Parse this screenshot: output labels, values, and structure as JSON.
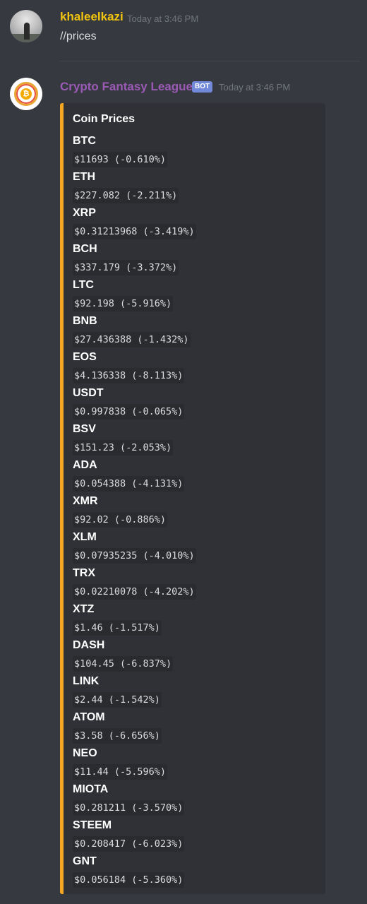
{
  "message1": {
    "username": "khaleelkazi",
    "username_color": "#f1c40f",
    "timestamp": "Today at 3:46 PM",
    "content": "//prices"
  },
  "message2": {
    "username": "Crypto Fantasy League",
    "username_color": "#9b59b6",
    "bot_tag": "BOT",
    "timestamp": "Today at 3:46 PM",
    "embed": {
      "accent_color": "#f5a623",
      "title": "Coin Prices",
      "coins": [
        {
          "name": "BTC",
          "value": "$11693 (-0.610%)"
        },
        {
          "name": "ETH",
          "value": "$227.082 (-2.211%)"
        },
        {
          "name": "XRP",
          "value": "$0.31213968 (-3.419%)"
        },
        {
          "name": "BCH",
          "value": "$337.179 (-3.372%)"
        },
        {
          "name": "LTC",
          "value": "$92.198 (-5.916%)"
        },
        {
          "name": "BNB",
          "value": "$27.436388 (-1.432%)"
        },
        {
          "name": "EOS",
          "value": "$4.136338 (-8.113%)"
        },
        {
          "name": "USDT",
          "value": "$0.997838 (-0.065%)"
        },
        {
          "name": "BSV",
          "value": "$151.23 (-2.053%)"
        },
        {
          "name": "ADA",
          "value": "$0.054388 (-4.131%)"
        },
        {
          "name": "XMR",
          "value": "$92.02 (-0.886%)"
        },
        {
          "name": "XLM",
          "value": "$0.07935235 (-4.010%)"
        },
        {
          "name": "TRX",
          "value": "$0.02210078 (-4.202%)"
        },
        {
          "name": "XTZ",
          "value": "$1.46 (-1.517%)"
        },
        {
          "name": "DASH",
          "value": "$104.45 (-6.837%)"
        },
        {
          "name": "LINK",
          "value": "$2.44 (-1.542%)"
        },
        {
          "name": "ATOM",
          "value": "$3.58 (-6.656%)"
        },
        {
          "name": "NEO",
          "value": "$11.44 (-5.596%)"
        },
        {
          "name": "MIOTA",
          "value": "$0.281211 (-3.570%)"
        },
        {
          "name": "STEEM",
          "value": "$0.208417 (-6.023%)"
        },
        {
          "name": "GNT",
          "value": "$0.056184 (-5.360%)"
        }
      ]
    }
  }
}
